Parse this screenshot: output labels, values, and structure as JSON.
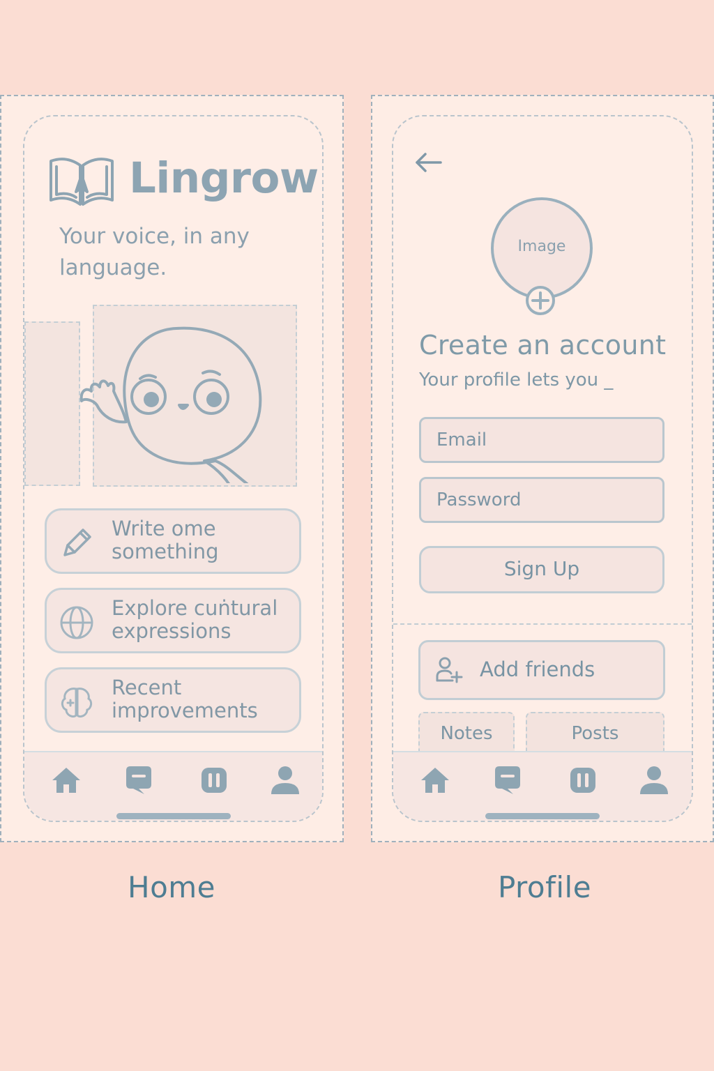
{
  "screens": {
    "home": {
      "label": "Home",
      "app_title": "Lingrow",
      "tagline": "Your voice, in any language.",
      "menu": [
        {
          "label": "Write  ome something",
          "icon": "pencil-icon"
        },
        {
          "label": "Explore cuṅtural expressions",
          "icon": "globe-icon"
        },
        {
          "label": "Recent improvements",
          "icon": "brain-icon"
        }
      ]
    },
    "profile": {
      "label": "Profile",
      "avatar_placeholder": "Image",
      "title": "Create an account",
      "subtitle": "Your profile lets you _",
      "email_placeholder": "Email",
      "password_placeholder": "Password",
      "signup_label": "Sign Up",
      "add_friends_label": "Add friends",
      "tabs": [
        "Notes",
        "Posts"
      ]
    }
  },
  "tabbar": {
    "items": [
      "home-icon",
      "chat-icon",
      "pause-icon",
      "user-icon"
    ]
  },
  "colors": {
    "background": "#fbddd3",
    "accent": "#8da4b2",
    "label_text": "#4e7d92"
  }
}
